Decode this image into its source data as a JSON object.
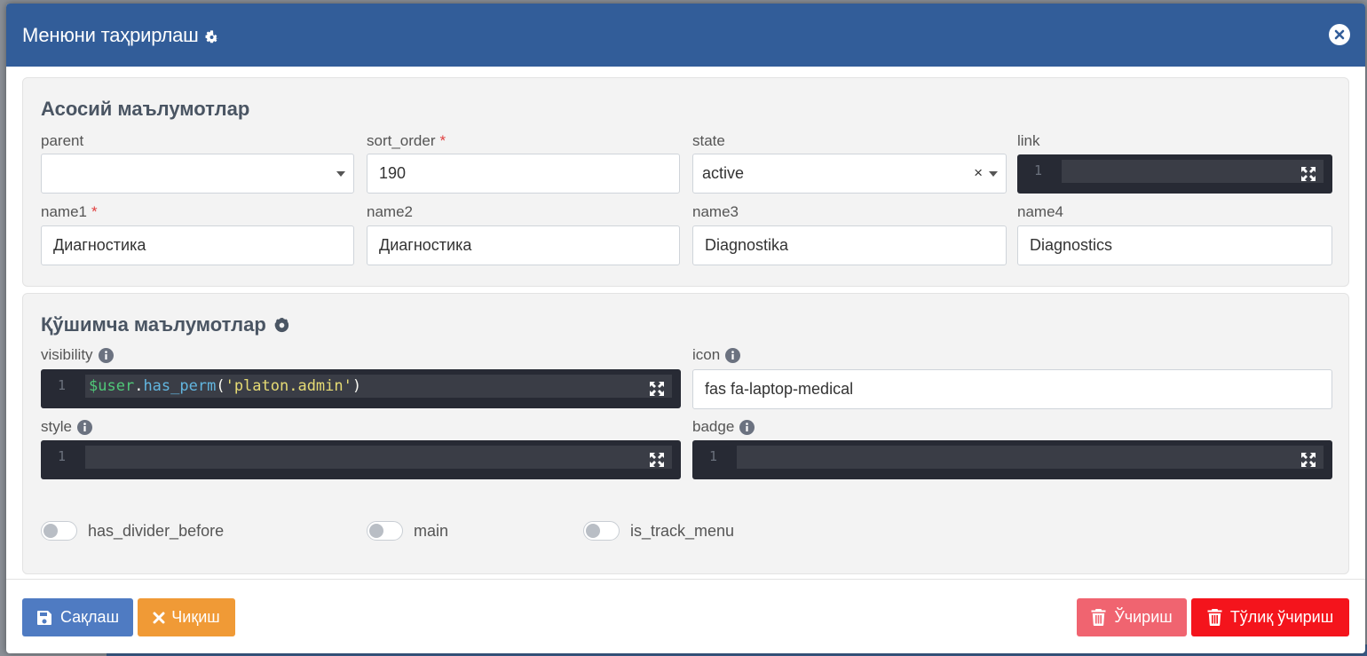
{
  "modal": {
    "title": "Менюни таҳрирлаш",
    "close_icon": "close-circle-icon"
  },
  "main_panel": {
    "title": "Асосий маълумотлар",
    "fields": {
      "parent": {
        "label": "parent",
        "value": ""
      },
      "sort_order": {
        "label": "sort_order",
        "required": "*",
        "value": "190"
      },
      "state": {
        "label": "state",
        "value": "active",
        "clear": "×"
      },
      "link": {
        "label": "link",
        "line_number": "1",
        "value": ""
      },
      "name1": {
        "label": "name1",
        "required": "*",
        "value": "Диагностика"
      },
      "name2": {
        "label": "name2",
        "value": "Диагностика"
      },
      "name3": {
        "label": "name3",
        "value": "Diagnostika"
      },
      "name4": {
        "label": "name4",
        "value": "Diagnostics"
      }
    }
  },
  "extra_panel": {
    "title": "Қўшимча маълумотлар",
    "fields": {
      "visibility": {
        "label": "visibility",
        "line_number": "1",
        "code": {
          "var": "$user",
          "dot": ".",
          "fn": "has_perm",
          "open": "(",
          "str": "'platon.admin'",
          "close": ")"
        }
      },
      "icon": {
        "label": "icon",
        "value": "fas fa-laptop-medical"
      },
      "style": {
        "label": "style",
        "line_number": "1",
        "value": ""
      },
      "badge": {
        "label": "badge",
        "line_number": "1",
        "value": ""
      }
    },
    "toggles": [
      {
        "label": "has_divider_before",
        "checked": false
      },
      {
        "label": "main",
        "checked": false
      },
      {
        "label": "is_track_menu",
        "checked": false
      }
    ]
  },
  "footer": {
    "save_label": "Сақлаш",
    "exit_label": "Чиқиш",
    "delete_label": "Ўчириш",
    "full_delete_label": "Тўлиқ ўчириш"
  },
  "colors": {
    "header": "#325d99",
    "save": "#4f7bc2",
    "exit": "#f09a36",
    "delete": "#f06470",
    "full_delete": "#f4141c",
    "code_bg": "#272a34"
  }
}
